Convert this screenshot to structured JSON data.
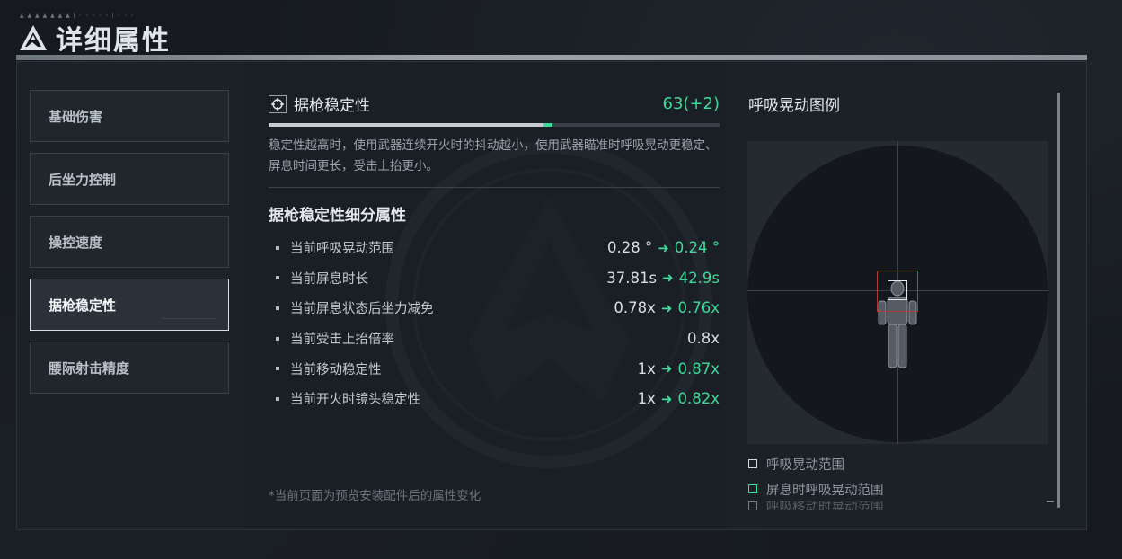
{
  "header": {
    "caption": "▲ ▲ ▲ ▲ ▲ ▲ ▲ | ◦ ◦ ◦ ◦ ◦ | ◦ ◦ ◦",
    "title": "详细属性",
    "logo_icon": "triangle-logo-icon"
  },
  "sidebar": {
    "items": [
      {
        "label": "基础伤害",
        "active": false
      },
      {
        "label": "后坐力控制",
        "active": false
      },
      {
        "label": "操控速度",
        "active": false
      },
      {
        "label": "据枪稳定性",
        "active": true
      },
      {
        "label": "腰际射击精度",
        "active": false
      }
    ]
  },
  "main": {
    "stat_icon": "crosshair-icon",
    "stat_name": "据枪稳定性",
    "stat_score": "63(+2)",
    "bar_base_fraction": 0.61,
    "bar_bonus_fraction": 0.02,
    "description": "稳定性越高时，使用武器连续开火时的抖动越小，使用武器瞄准时呼吸晃动更稳定、屏息时间更长，受击上抬更小。",
    "subsection_title": "据枪稳定性细分属性",
    "rows": [
      {
        "label": "当前呼吸晃动范围",
        "old": "0.28 °",
        "new": "0.24 °"
      },
      {
        "label": "当前屏息时长",
        "old": "37.81s",
        "new": "42.9s"
      },
      {
        "label": "当前屏息状态后坐力减免",
        "old": "0.78x",
        "new": "0.76x"
      },
      {
        "label": "当前受击上抬倍率",
        "old": "0.8x",
        "new": ""
      },
      {
        "label": "当前移动稳定性",
        "old": "1x",
        "new": "0.87x"
      },
      {
        "label": "当前开火时镜头稳定性",
        "old": "1x",
        "new": "0.82x"
      }
    ],
    "arrow_icon": "arrow-right-icon",
    "footnote": "*当前页面为预览安装配件后的属性变化"
  },
  "legend": {
    "title": "呼吸晃动图例",
    "items": [
      {
        "label": "呼吸晃动范围",
        "color": "#d3d8dc"
      },
      {
        "label": "屏息时呼吸晃动范围",
        "color": "#3fd99a"
      },
      {
        "label": "呼吸移动时晃动范围",
        "color": "#d3d8dc"
      }
    ]
  },
  "colors": {
    "accent_green": "#3fd99a",
    "active_border": "#d9dee2",
    "breath_rect": "#b53a33"
  }
}
